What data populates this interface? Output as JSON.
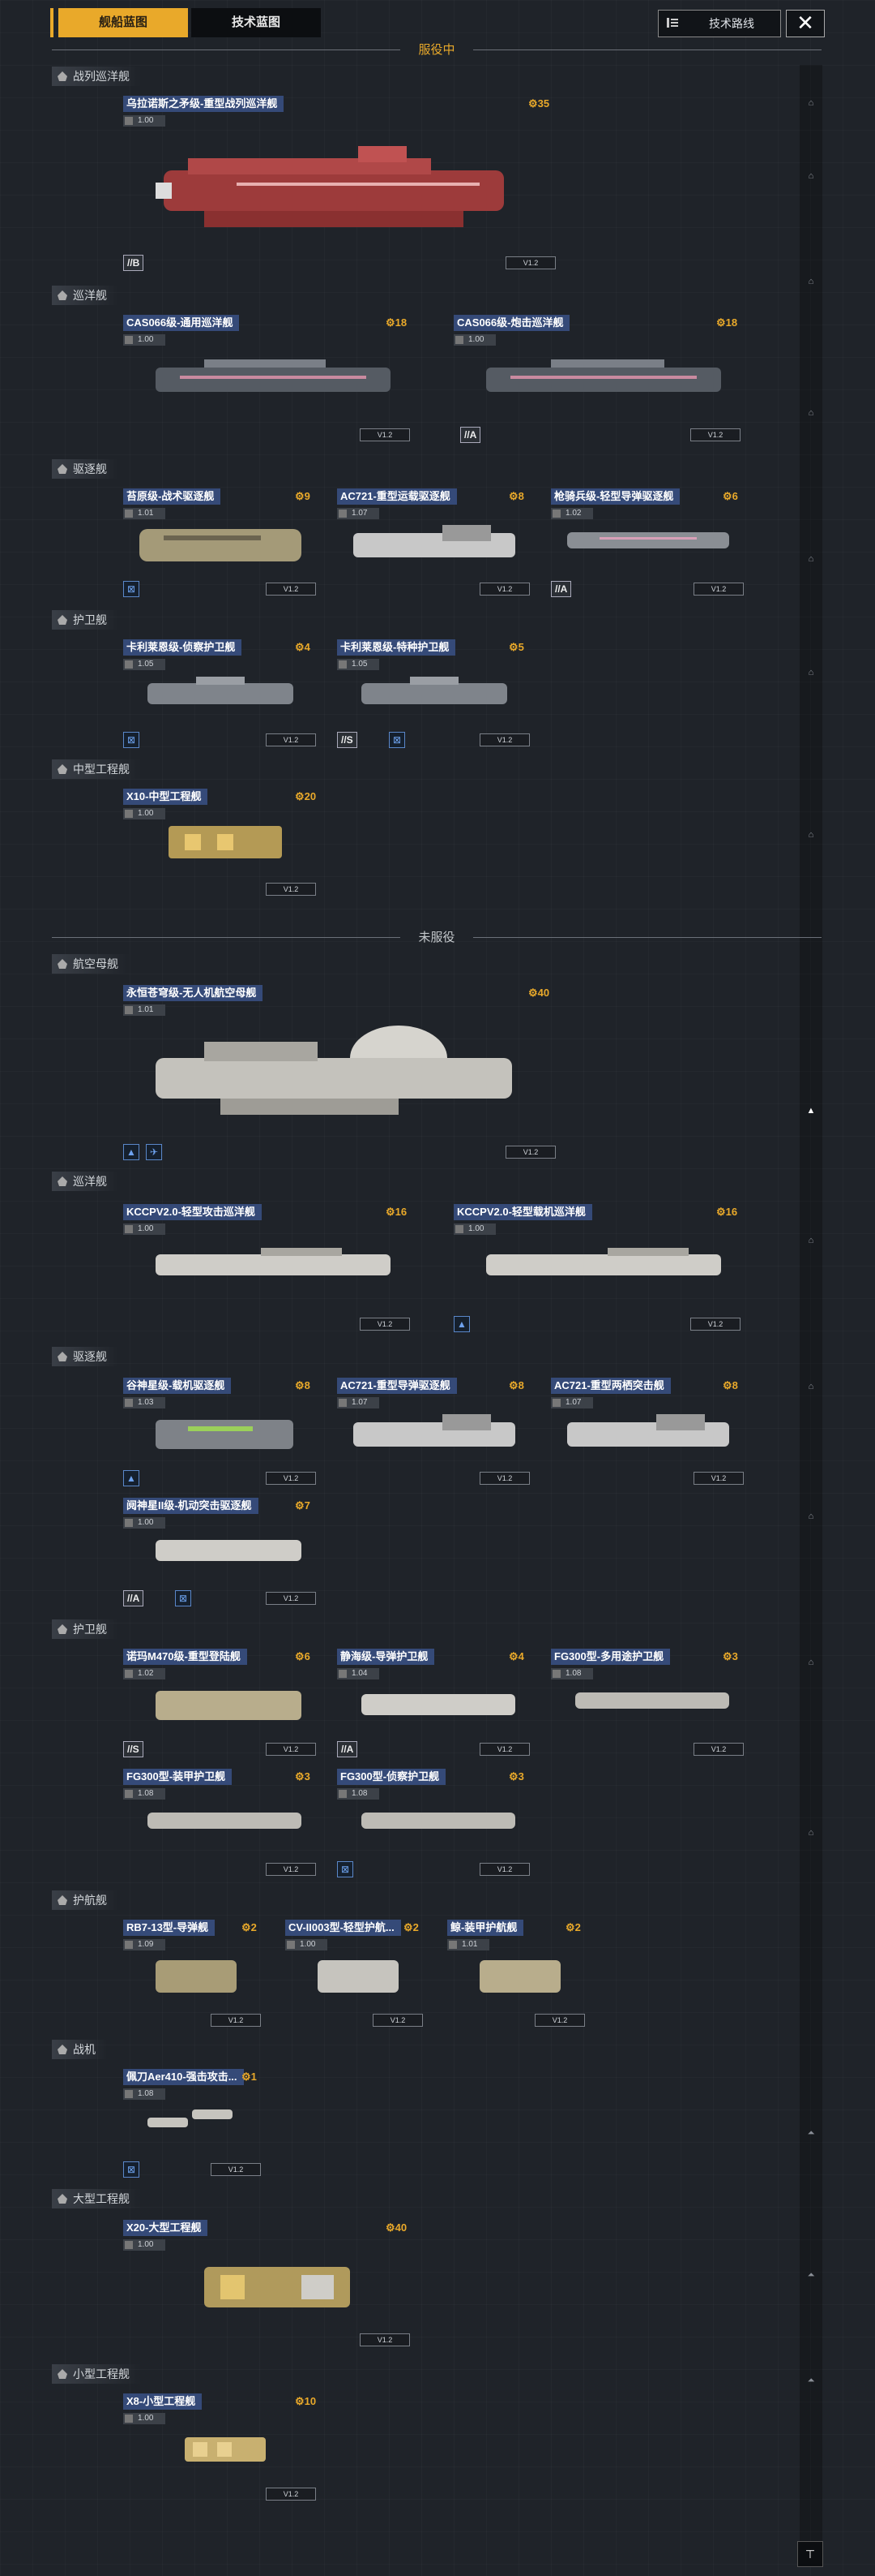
{
  "tabs": {
    "ship_blueprint": "舰船蓝图",
    "tech_blueprint": "技术蓝图"
  },
  "header": {
    "tech_route": "技术路线",
    "close": "✕"
  },
  "sections": {
    "active": "服役中",
    "inactive": "未服役"
  },
  "categories": {
    "battlecruiser": "战列巡洋舰",
    "cruiser_a": "巡洋舰",
    "destroyer_a": "驱逐舰",
    "frigate_a": "护卫舰",
    "medium_eng_a": "中型工程舰",
    "carrier": "航空母舰",
    "cruiser_b": "巡洋舰",
    "destroyer_b": "驱逐舰",
    "frigate_b": "护卫舰",
    "corvette": "护航舰",
    "fighter": "战机",
    "large_eng": "大型工程舰",
    "small_eng": "小型工程舰"
  },
  "ships": {
    "uranos": {
      "name": "乌拉诺斯之矛级-重型战列巡洋舰",
      "cost": "35",
      "tier": "1.00",
      "badge": "//B"
    },
    "cas066_a": {
      "name": "CAS066级-通用巡洋舰",
      "cost": "18",
      "tier": "1.00",
      "badge": ""
    },
    "cas066_b": {
      "name": "CAS066级-炮击巡洋舰",
      "cost": "18",
      "tier": "1.00",
      "badge": "//A"
    },
    "xuanyuan": {
      "name": "苔原级-战术驱逐舰",
      "cost": "9",
      "tier": "1.01",
      "badge": ""
    },
    "ac721_a": {
      "name": "AC721-重型运载驱逐舰",
      "cost": "8",
      "tier": "1.07",
      "badge": ""
    },
    "qianqi": {
      "name": "枪骑兵级-轻型导弹驱逐舰",
      "cost": "6",
      "tier": "1.02",
      "badge": "//A"
    },
    "kalisa_a": {
      "name": "卡利莱恩级-侦察护卫舰",
      "cost": "4",
      "tier": "1.05",
      "badge": ""
    },
    "kalisa_b": {
      "name": "卡利莱恩级-特种护卫舰",
      "cost": "5",
      "tier": "1.05",
      "badge": "//S"
    },
    "x10": {
      "name": "X10-中型工程舰",
      "cost": "20",
      "tier": "1.00",
      "badge": ""
    },
    "yonghengcang": {
      "name": "永恒苍穹级-无人机航空母舰",
      "cost": "40",
      "tier": "1.01",
      "badge": ""
    },
    "kccp_a": {
      "name": "KCCPV2.0-轻型攻击巡洋舰",
      "cost": "16",
      "tier": "1.00",
      "badge": ""
    },
    "kccp_b": {
      "name": "KCCPV2.0-轻型载机巡洋舰",
      "cost": "16",
      "tier": "1.00",
      "badge": ""
    },
    "gushen": {
      "name": "谷神星级-载机驱逐舰",
      "cost": "8",
      "tier": "1.03",
      "badge": ""
    },
    "ac721_b": {
      "name": "AC721-重型导弹驱逐舰",
      "cost": "8",
      "tier": "1.07",
      "badge": ""
    },
    "ac721_c": {
      "name": "AC721-重型两栖突击舰",
      "cost": "8",
      "tier": "1.07",
      "badge": ""
    },
    "yueshen": {
      "name": "阋神星II级-机动突击驱逐舰",
      "cost": "7",
      "tier": "1.00",
      "badge": "//A"
    },
    "nuolan": {
      "name": "诺玛M470级-重型登陆舰",
      "cost": "6",
      "tier": "1.02",
      "badge": "//S"
    },
    "jinghai": {
      "name": "静海级-导弹护卫舰",
      "cost": "4",
      "tier": "1.04",
      "badge": "//A"
    },
    "fg300_a": {
      "name": "FG300型-多用途护卫舰",
      "cost": "3",
      "tier": "1.08",
      "badge": ""
    },
    "fg300_b": {
      "name": "FG300型-装甲护卫舰",
      "cost": "3",
      "tier": "1.08",
      "badge": ""
    },
    "fg300_c": {
      "name": "FG300型-侦察护卫舰",
      "cost": "3",
      "tier": "1.08",
      "badge": ""
    },
    "rb7": {
      "name": "RB7-13型-导弹舰",
      "cost": "2",
      "tier": "1.09",
      "badge": ""
    },
    "cv11003": {
      "name": "CV-II003型-轻型护航...",
      "cost": "2",
      "tier": "1.00",
      "badge": ""
    },
    "ying": {
      "name": "鲸-装甲护航舰",
      "cost": "2",
      "tier": "1.01",
      "badge": ""
    },
    "peidao": {
      "name": "佩刀Aer410-强击攻击...",
      "cost": "1",
      "tier": "1.08",
      "badge": ""
    },
    "x20": {
      "name": "X20-大型工程舰",
      "cost": "40",
      "tier": "1.00",
      "badge": ""
    },
    "x8": {
      "name": "X8-小型工程舰",
      "cost": "10",
      "tier": "1.00",
      "badge": ""
    }
  },
  "status_label": "V1.2",
  "colors": {
    "accent": "#e9a92a",
    "name_bg": "#354a78",
    "badge_blue": "#6ea2ee"
  }
}
